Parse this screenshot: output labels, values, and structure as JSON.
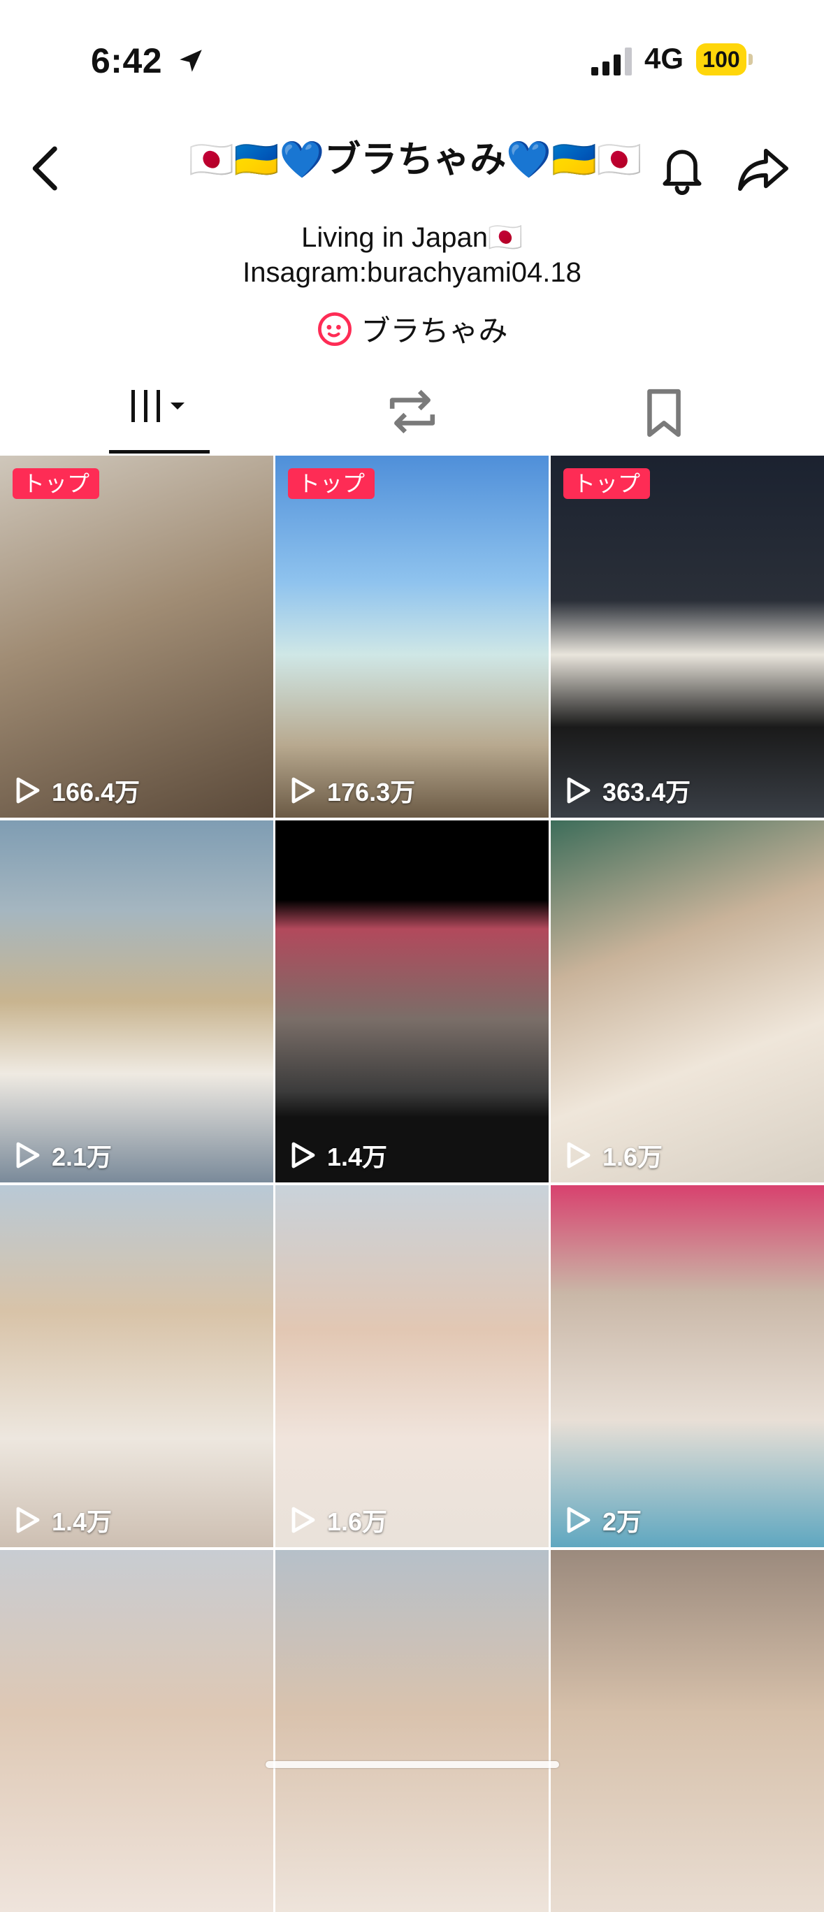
{
  "status_bar": {
    "time": "6:42",
    "network": "4G",
    "battery": "100"
  },
  "header": {
    "title": "🇯🇵🇺🇦💙ブラちゃみ💙🇺🇦🇯🇵"
  },
  "bio": {
    "line1": "Living in Japan🇯🇵",
    "line2": "Insagram:burachyami04.18",
    "nickname": "ブラちゃみ"
  },
  "colors": {
    "accent": "#fe2c55",
    "battery": "#ffd60a"
  },
  "tabs": [
    "grid-videos-icon",
    "repost-icon",
    "bookmark-icon"
  ],
  "videos": [
    {
      "badge": "トップ",
      "views": "166.4万",
      "bg": "linear-gradient(160deg,#cfc7bb 0%,#a08c74 45%,#5b4a3a 100%)"
    },
    {
      "badge": "トップ",
      "views": "176.3万",
      "bg": "linear-gradient(180deg,#4f8fd9 0%,#8fc3ee 35%,#cfe7e6 55%,#b8a98f 80%,#6b5a45 100%)"
    },
    {
      "badge": "トップ",
      "views": "363.4万",
      "bg": "linear-gradient(180deg,#1b2230 0%,#2a2f38 40%,#e9e5dc 55%,#1a1a1a 75%,#3a3f46 100%)"
    },
    {
      "badge": "",
      "views": "2.1万",
      "bg": "linear-gradient(180deg,#7f9db3 0%,#a5b6c0 25%,#c8b48f 50%,#efeae2 70%,#7a8a9a 100%)"
    },
    {
      "badge": "",
      "views": "1.4万",
      "bg": "linear-gradient(180deg,#000 0%,#000 22%,#b2495c 30%,#7a6e68 55%,#3b3b3b 75%,#111 82%,#111 100%)"
    },
    {
      "badge": "",
      "views": "1.6万",
      "bg": "linear-gradient(160deg,#3d6d5a 0%,#c9b39a 35%,#efe6da 65%,#d7cfc3 100%)"
    },
    {
      "badge": "",
      "views": "1.4万",
      "bg": "linear-gradient(180deg,#b9c9d6 0%,#d8c3a8 35%,#ede7df 70%,#cdbfb2 100%)"
    },
    {
      "badge": "",
      "views": "1.6万",
      "bg": "linear-gradient(180deg,#c9d2da 0%,#e2c7b3 40%,#f0e4dc 70%,#e9e2da 100%)"
    },
    {
      "badge": "",
      "views": "2万",
      "bg": "linear-gradient(180deg,#d8416e 0%,#c9b7a7 30%,#e8dfd6 65%,#5fa7c0 100%)"
    },
    {
      "badge": "",
      "views": "",
      "bg": "linear-gradient(180deg,#c8ccd2 0%,#dec8b4 45%,#efe4dc 100%)"
    },
    {
      "badge": "",
      "views": "",
      "bg": "linear-gradient(180deg,#b6c0c9 0%,#d9c2ad 45%,#eee4db 100%)"
    },
    {
      "badge": "",
      "views": "",
      "bg": "linear-gradient(180deg,#9b8a7d 0%,#d6c0aa 45%,#e9ddd2 100%)"
    }
  ]
}
